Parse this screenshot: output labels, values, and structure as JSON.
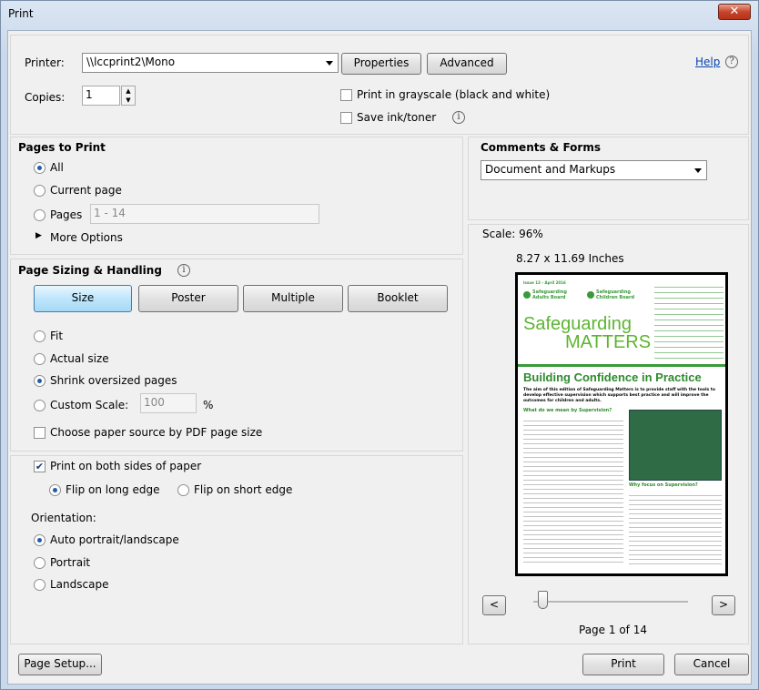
{
  "window": {
    "title": "Print",
    "close_label": "✕"
  },
  "printer": {
    "label": "Printer:",
    "selected": "\\\\lccprint2\\Mono",
    "properties_label": "Properties",
    "advanced_label": "Advanced",
    "help_label": "Help",
    "copies_label": "Copies:",
    "copies_value": "1",
    "grayscale_label": "Print in grayscale (black and white)",
    "save_ink_label": "Save ink/toner"
  },
  "pages_to_print": {
    "title": "Pages to Print",
    "all_label": "All",
    "current_label": "Current page",
    "pages_label": "Pages",
    "pages_value": "1 - 14",
    "more_options_label": "More Options"
  },
  "sizing": {
    "title": "Page Sizing & Handling",
    "size_label": "Size",
    "poster_label": "Poster",
    "multiple_label": "Multiple",
    "booklet_label": "Booklet",
    "fit_label": "Fit",
    "actual_label": "Actual size",
    "shrink_label": "Shrink oversized pages",
    "custom_label": "Custom Scale:",
    "custom_value": "100",
    "percent": "%",
    "paper_source_label": "Choose paper source by PDF page size"
  },
  "duplex": {
    "both_sides_label": "Print on both sides of paper",
    "long_edge_label": "Flip on long edge",
    "short_edge_label": "Flip on short edge"
  },
  "orientation": {
    "title": "Orientation:",
    "auto_label": "Auto portrait/landscape",
    "portrait_label": "Portrait",
    "landscape_label": "Landscape"
  },
  "comments": {
    "title": "Comments & Forms",
    "selected": "Document and Markups"
  },
  "preview": {
    "scale_label": "Scale: 96%",
    "size_label": "8.27 x 11.69 Inches",
    "prev_label": "<",
    "next_label": ">",
    "page_label": "Page 1 of 14",
    "doc": {
      "issue": "Issue 13 – April 2016",
      "logo1": "Safeguarding Adults Board",
      "logo2": "Safeguarding Children Board",
      "masthead1": "Safeguarding",
      "masthead2": "MATTERS",
      "headline": "Building Confidence in Practice",
      "intro": "The aim of this edition of Safeguarding Matters is to provide staff with the tools to develop effective supervision which supports best practice and will improve the outcomes for children and adults.",
      "section1": "What do we mean by Supervision?",
      "section2": "Why focus on Supervision?"
    }
  },
  "footer": {
    "page_setup_label": "Page Setup...",
    "print_label": "Print",
    "cancel_label": "Cancel"
  },
  "colors": {
    "accent_green": "#3a9a3a",
    "masthead_green": "#5cb531",
    "headline_green": "#2e8b2e"
  }
}
